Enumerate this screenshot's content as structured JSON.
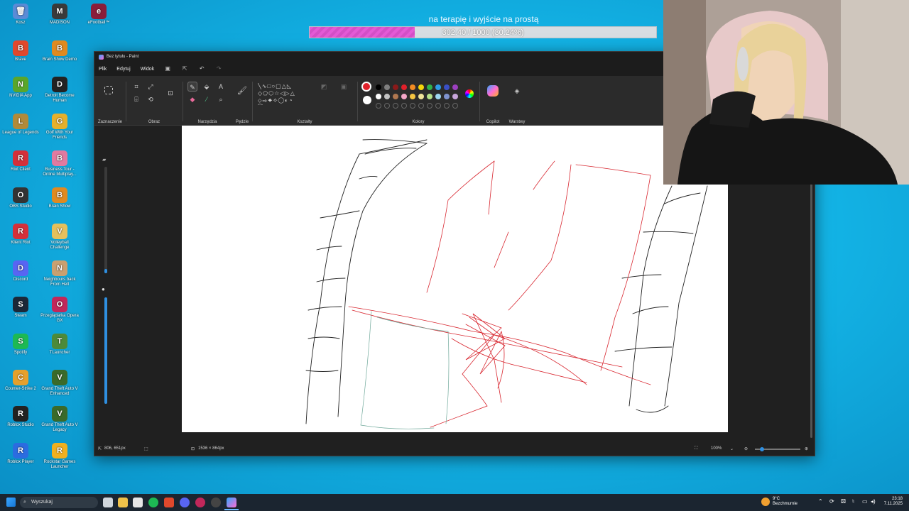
{
  "desktop": {
    "icons": [
      {
        "label": "Kosz",
        "color": "#5a8bd6",
        "glyph": "🗑"
      },
      {
        "label": "MADISON",
        "color": "#3a3a3a",
        "glyph": "M"
      },
      {
        "label": "eFootball™",
        "color": "#8a1d3a",
        "glyph": "e"
      },
      {
        "label": "Brave",
        "color": "#e0482c",
        "glyph": "B"
      },
      {
        "label": "Brain Show Demo",
        "color": "#e08a20",
        "glyph": "B"
      },
      {
        "label": "NVIDIA App",
        "color": "#5aa62a",
        "glyph": "N"
      },
      {
        "label": "Detroit Become Human",
        "color": "#222",
        "glyph": "D"
      },
      {
        "label": "League of Legends",
        "color": "#b08a3a",
        "glyph": "L"
      },
      {
        "label": "Golf With Your Friends",
        "color": "#e5b02c",
        "glyph": "G"
      },
      {
        "label": "Riot Client",
        "color": "#d5303a",
        "glyph": "R"
      },
      {
        "label": "Business Tour - Online Multiplay...",
        "color": "#e07aa0",
        "glyph": "B"
      },
      {
        "label": "OBS Studio",
        "color": "#333",
        "glyph": "O"
      },
      {
        "label": "Brain Show",
        "color": "#e08a20",
        "glyph": "B"
      },
      {
        "label": "Klient Riot",
        "color": "#d5303a",
        "glyph": "R"
      },
      {
        "label": "Volleyball Challenge",
        "color": "#e5c05c",
        "glyph": "V"
      },
      {
        "label": "Discord",
        "color": "#5865f2",
        "glyph": "D"
      },
      {
        "label": "Neighbours back From Hell",
        "color": "#c9a070",
        "glyph": "N"
      },
      {
        "label": "Steam",
        "color": "#1b2838",
        "glyph": "S"
      },
      {
        "label": "Przeglądarka Opera GX",
        "color": "#c1275a",
        "glyph": "O"
      },
      {
        "label": "Spotify",
        "color": "#1db954",
        "glyph": "S"
      },
      {
        "label": "TLauncher",
        "color": "#4c8a3a",
        "glyph": "T"
      },
      {
        "label": "Counter-Strike 2",
        "color": "#e5a02c",
        "glyph": "C"
      },
      {
        "label": "Grand Theft Auto V Enhanced",
        "color": "#3a6a2a",
        "glyph": "V"
      },
      {
        "label": "Roblox Studio",
        "color": "#222",
        "glyph": "R"
      },
      {
        "label": "Grand Theft Auto V Legacy",
        "color": "#3a6a2a",
        "glyph": "V"
      },
      {
        "label": "Roblox Player",
        "color": "#2b6ce0",
        "glyph": "R"
      },
      {
        "label": "Rockstar Games Launcher",
        "color": "#f0b020",
        "glyph": "R"
      }
    ]
  },
  "goal": {
    "title": "na terapię i wyjście na prostą",
    "progress_text": "302.40 / 1000 (30.24%)",
    "progress_fraction": 0.3024
  },
  "paint": {
    "title": "Bez tytułu - Paint",
    "menu": [
      "Plik",
      "Edytuj",
      "Widok"
    ],
    "groups": {
      "selection": "Zaznaczenie",
      "image": "Obraz",
      "tools": "Narzędzia",
      "brushes": "Pędzle",
      "shapes": "Kształty",
      "colors": "Kolory",
      "copilot": "Copilot",
      "layers": "Warstwy"
    },
    "palette": [
      "#000000",
      "#7f7f7f",
      "#8b1a1a",
      "#e0202a",
      "#f28b22",
      "#f5d60a",
      "#2fb24c",
      "#2e9be8",
      "#3a4fc6",
      "#9b3fbf",
      "#ffffff",
      "#c3c3c3",
      "#b07850",
      "#f4a6c8",
      "#f5c542",
      "#efe49a",
      "#b6e28a",
      "#9fd7f0",
      "#7f93cf",
      "#c8a6dc"
    ],
    "current_color": "#e0202a",
    "secondary_color": "#ffffff",
    "status": {
      "cursor": "806, 651px",
      "size": "1536 × 864px",
      "zoom": "100%"
    }
  },
  "taskbar": {
    "search_placeholder": "Wyszukaj",
    "weather_temp": "9°C",
    "weather_desc": "Bezchmurnie",
    "time": "23:18",
    "date": "7.11.2025"
  }
}
